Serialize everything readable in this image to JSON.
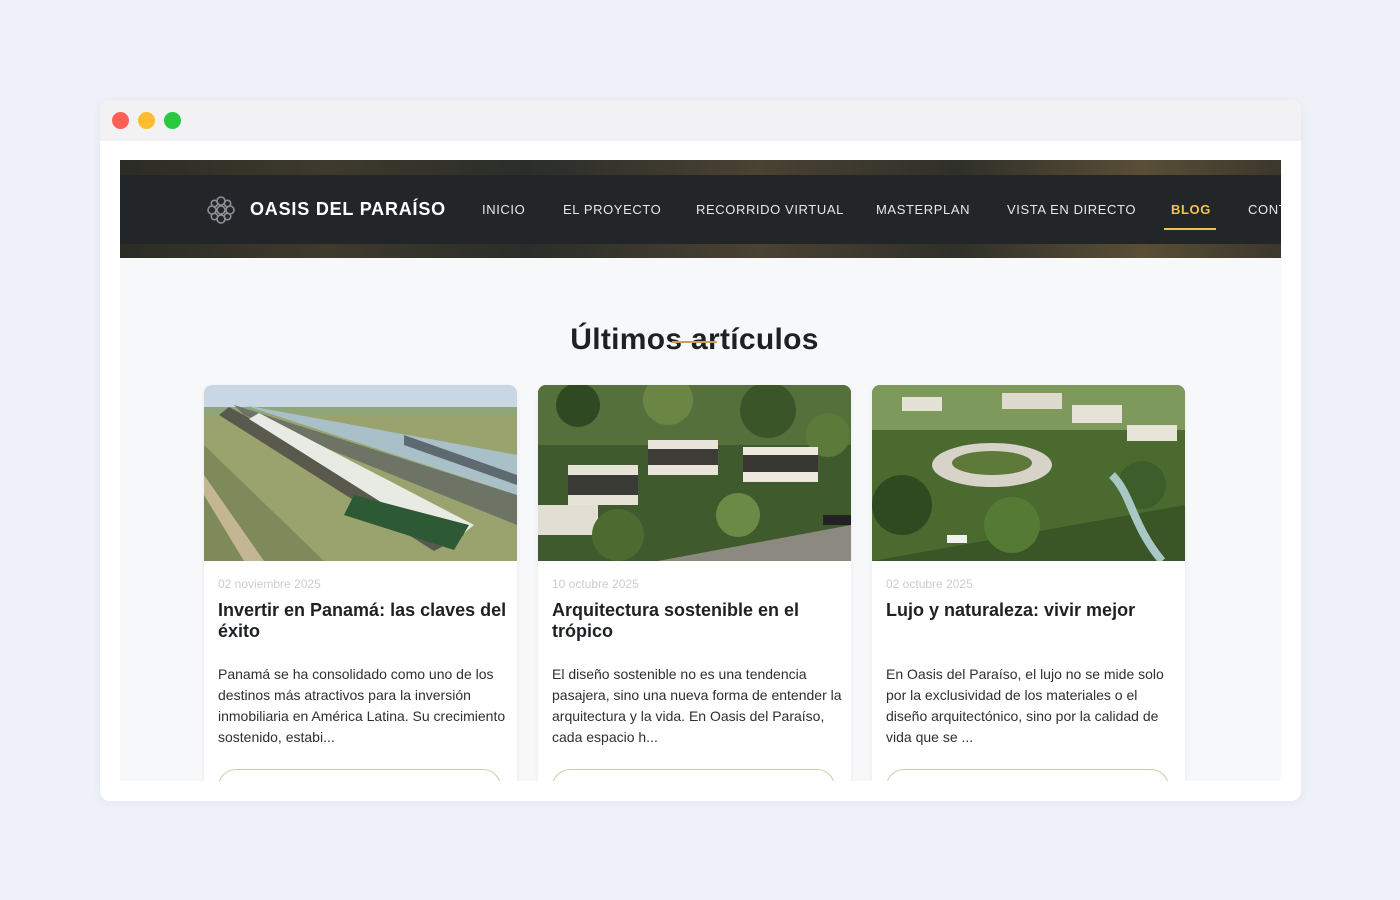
{
  "browser": {
    "controls": [
      "close",
      "minimize",
      "maximize"
    ]
  },
  "navbar": {
    "brand": "OASIS DEL PARAÍSO",
    "logo_icon": "spiral-flower-icon",
    "items": [
      {
        "label": "INICIO",
        "active": false
      },
      {
        "label": "EL PROYECTO",
        "active": false
      },
      {
        "label": "RECORRIDO VIRTUAL",
        "active": false
      },
      {
        "label": "MASTERPLAN",
        "active": false
      },
      {
        "label": "VISTA EN DIRECTO",
        "active": false
      },
      {
        "label": "BLOG",
        "active": true
      },
      {
        "label": "CONT",
        "active": false
      }
    ]
  },
  "section": {
    "title": "Últimos artículos"
  },
  "articles": [
    {
      "date": "02 noviembre 2025",
      "title": "Invertir en Panamá: las claves del éxito",
      "excerpt": "Panamá se ha consolidado como uno de los destinos más atractivos para la inversión inmobiliaria en América Latina. Su crecimiento sostenido, estabi...",
      "image": "panama-canal-ship-photo"
    },
    {
      "date": "10 octubre 2025",
      "title": "Arquitectura sostenible en el trópico",
      "excerpt": "El diseño sostenible no es una tendencia pasajera, sino una nueva forma de entender la arquitectura y la vida. En Oasis del Paraíso, cada espacio h...",
      "image": "tropical-terraced-houses-render"
    },
    {
      "date": "02 octubre 2025",
      "title": "Lujo y naturaleza: vivir mejor",
      "excerpt": "En Oasis del Paraíso, el lujo no se mide solo por la exclusividad de los materiales o el diseño arquitectónico, sino por la calidad de vida que se ...",
      "image": "resort-aerial-render"
    }
  ],
  "colors": {
    "page_bg": "#eef2f8",
    "navbar_bg": "#232629",
    "accent": "#f0c44c",
    "title_rule": "#c9a15c"
  }
}
